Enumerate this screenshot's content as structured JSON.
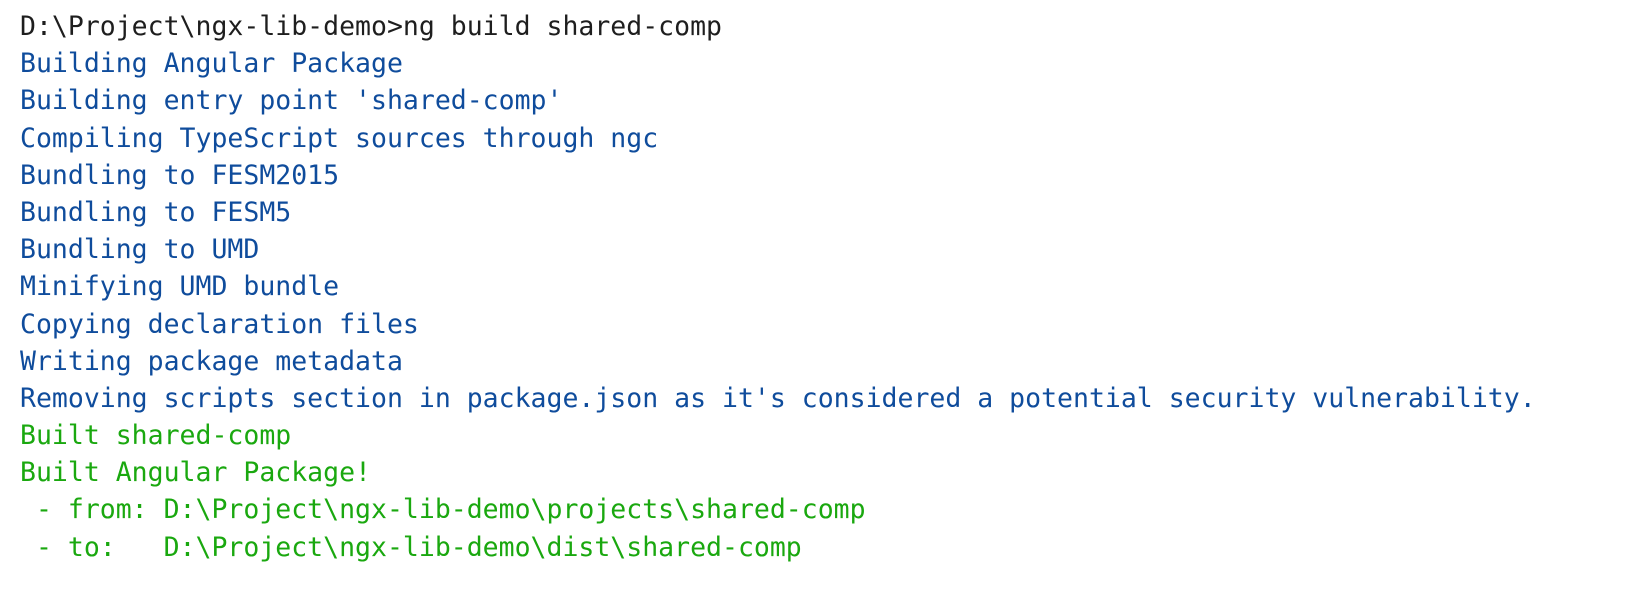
{
  "terminal": {
    "prompt_line": "D:\\Project\\ngx-lib-demo>ng build shared-comp",
    "info_lines": [
      "Building Angular Package",
      "Building entry point 'shared-comp'",
      "Compiling TypeScript sources through ngc",
      "Bundling to FESM2015",
      "Bundling to FESM5",
      "Bundling to UMD",
      "Minifying UMD bundle",
      "Copying declaration files",
      "Writing package metadata",
      "Removing scripts section in package.json as it's considered a potential security vulnerability."
    ],
    "success_lines": [
      "Built shared-comp",
      "Built Angular Package!",
      " - from: D:\\Project\\ngx-lib-demo\\projects\\shared-comp",
      " - to:   D:\\Project\\ngx-lib-demo\\dist\\shared-comp"
    ]
  },
  "colors": {
    "background": "#ffffff",
    "command_text": "#1e1e1e",
    "info_text": "#0f4c9c",
    "success_text": "#1aa80f"
  }
}
